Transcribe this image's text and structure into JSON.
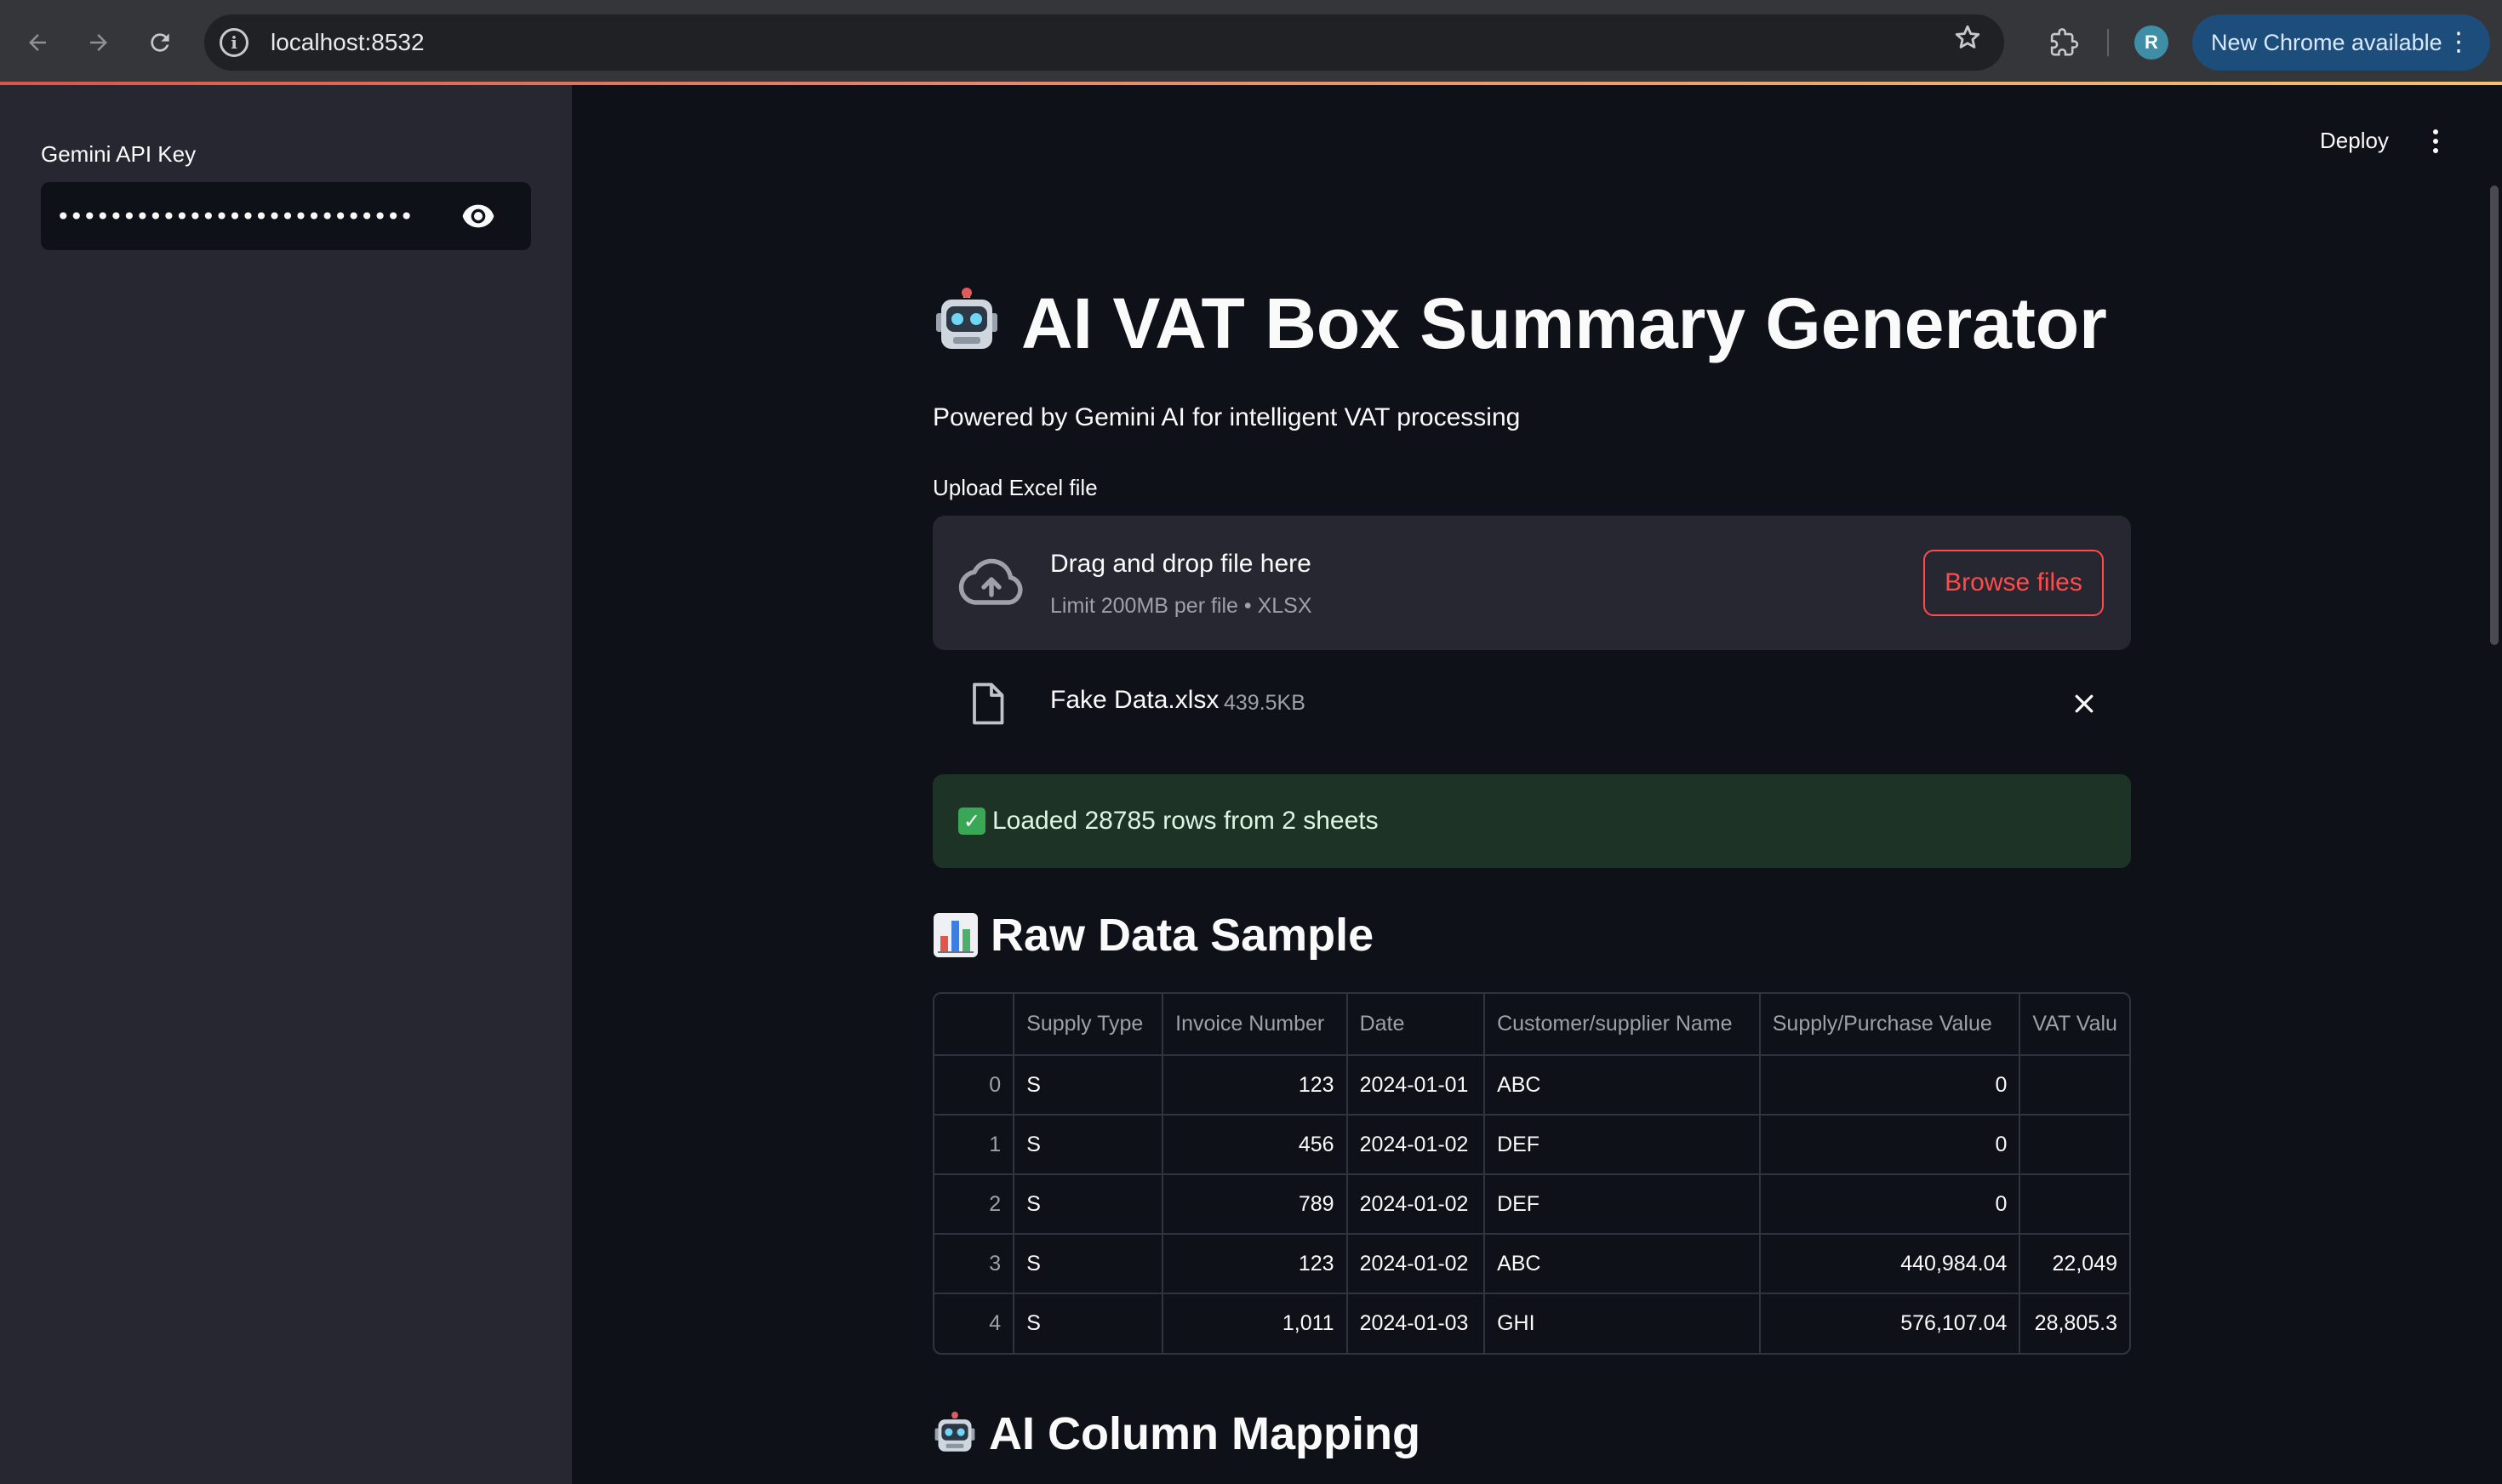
{
  "browser": {
    "url": "localhost:8532",
    "profile_initial": "R",
    "update_label": "New Chrome available"
  },
  "sidebar": {
    "api_key_label": "Gemini API Key",
    "api_key_value": "••••••••••••••••••••••••••••••••••••••••"
  },
  "header": {
    "deploy_label": "Deploy"
  },
  "page": {
    "title": "AI VAT Box Summary Generator",
    "subtitle": "Powered by Gemini AI for intelligent VAT processing"
  },
  "uploader": {
    "label": "Upload Excel file",
    "drop_text": "Drag and drop file here",
    "limit_text": "Limit 200MB per file • XLSX",
    "browse_label": "Browse files",
    "file_name": "Fake Data.xlsx",
    "file_size": "439.5KB"
  },
  "status": {
    "success_text": "Loaded 28785 rows from 2 sheets"
  },
  "raw_data": {
    "heading": "Raw Data Sample",
    "columns": [
      "",
      "Supply Type",
      "Invoice Number",
      "Date",
      "Customer/supplier Name",
      "Supply/Purchase Value",
      "VAT Valu"
    ],
    "rows": [
      [
        "0",
        "S",
        "123",
        "2024-01-01",
        "ABC",
        "0",
        ""
      ],
      [
        "1",
        "S",
        "456",
        "2024-01-02",
        "DEF",
        "0",
        ""
      ],
      [
        "2",
        "S",
        "789",
        "2024-01-02",
        "DEF",
        "0",
        ""
      ],
      [
        "3",
        "S",
        "123",
        "2024-01-02",
        "ABC",
        "440,984.04",
        "22,049"
      ],
      [
        "4",
        "S",
        "1,011",
        "2024-01-03",
        "GHI",
        "576,107.04",
        "28,805.3"
      ]
    ]
  },
  "mapping": {
    "heading": "AI Column Mapping"
  },
  "icons": {
    "title": "robot-icon",
    "raw_data": "bar-chart-icon",
    "mapping": "robot-icon"
  },
  "colors": {
    "accent": "#ff4b4b",
    "background": "#0e1117",
    "sidebar": "#262730",
    "success_bg": "#1c3325"
  }
}
